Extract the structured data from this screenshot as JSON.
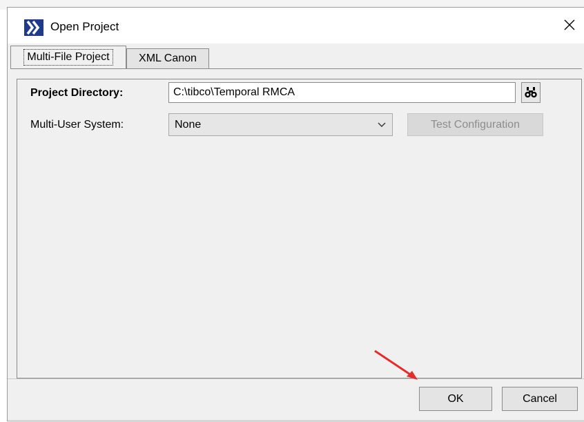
{
  "window": {
    "title": "Open Project",
    "close_glyph": "✕",
    "icon": "tibco-logo-icon"
  },
  "tabs": [
    {
      "label": "Multi-File Project",
      "selected": true
    },
    {
      "label": "XML Canon",
      "selected": false
    }
  ],
  "form": {
    "project_directory_label": "Project Directory:",
    "project_directory_value": "C:\\tibco\\Temporal RMCA",
    "browse_icon": "binoculars-icon",
    "multi_user_label": "Multi-User System:",
    "multi_user_value": "None",
    "test_configuration_label": "Test Configuration",
    "test_configuration_enabled": false
  },
  "buttons": {
    "ok_label": "OK",
    "cancel_label": "Cancel"
  },
  "colors": {
    "dialog_bg": "#f0f0f0",
    "icon_blue": "#1f3a8a",
    "annotation_arrow": "#e52b2b",
    "disabled_text": "#8d8d8d"
  }
}
